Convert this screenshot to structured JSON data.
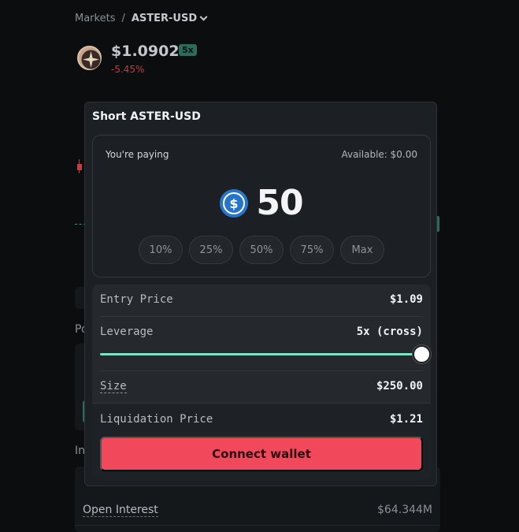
{
  "breadcrumb": {
    "root": "Markets",
    "separator": "/",
    "current": "ASTER-USD"
  },
  "market": {
    "price": "$1.0902",
    "leverage_badge": "5x",
    "change": "-5.45%"
  },
  "background": {
    "section_po": "Po",
    "section_in": "In",
    "open_interest_label": "Open Interest",
    "open_interest_value": "$64.344M"
  },
  "modal": {
    "title": "Short ASTER-USD",
    "paying_label": "You're paying",
    "available": "Available:  $0.00",
    "amount": "50",
    "token_icon": "usdc-icon",
    "percent_buttons": [
      "10%",
      "25%",
      "50%",
      "75%",
      "Max"
    ],
    "entry_price_label": "Entry Price",
    "entry_price_value": "$1.09",
    "leverage_label": "Leverage",
    "leverage_value": "5x (cross)",
    "leverage_fraction": 1.0,
    "size_label": "Size",
    "size_value": "$250.00",
    "liquidation_label": "Liquidation Price",
    "liquidation_value": "$1.21",
    "connect_label": "Connect wallet"
  },
  "colors": {
    "accent_red": "#f2485c",
    "slider": "#7de3c6",
    "negative": "#c23b48",
    "usdc": "#2775ca"
  }
}
